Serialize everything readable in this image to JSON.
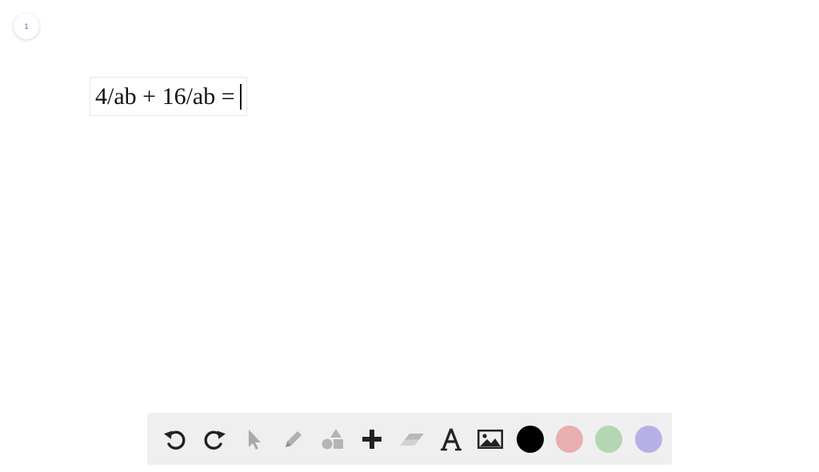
{
  "page": {
    "number": "1"
  },
  "editor": {
    "text": "4/ab + 16/ab ="
  },
  "toolbar": {
    "tools": [
      {
        "name": "undo-icon"
      },
      {
        "name": "redo-icon"
      },
      {
        "name": "select-pointer-icon"
      },
      {
        "name": "pencil-icon"
      },
      {
        "name": "shapes-icon"
      },
      {
        "name": "plus-icon"
      },
      {
        "name": "eraser-icon"
      },
      {
        "name": "text-tool-icon"
      },
      {
        "name": "image-icon"
      }
    ],
    "colors": [
      {
        "name": "black",
        "hex": "#000000"
      },
      {
        "name": "red",
        "hex": "#e8aeb0"
      },
      {
        "name": "green",
        "hex": "#b5d6b2"
      },
      {
        "name": "purple",
        "hex": "#b5b0e6"
      }
    ]
  }
}
